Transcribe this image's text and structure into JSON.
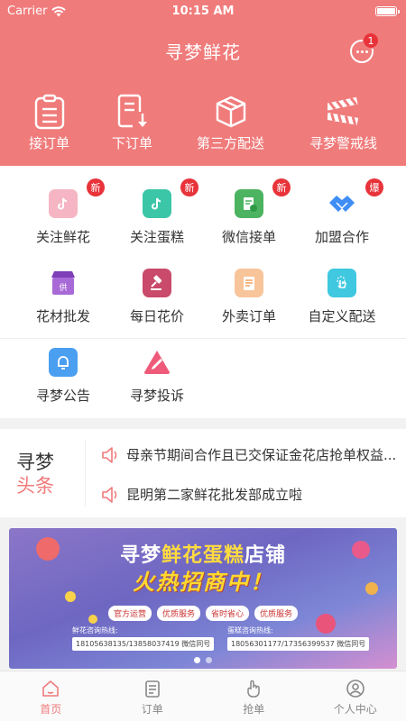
{
  "status_bar": {
    "carrier": "Carrier",
    "time": "10:15 AM"
  },
  "header": {
    "title": "寻梦鲜花",
    "message_badge": "1",
    "quick_actions": [
      {
        "label": "接订单",
        "icon": "receive-order-icon"
      },
      {
        "label": "下订单",
        "icon": "place-order-icon"
      },
      {
        "label": "第三方配送",
        "icon": "box-delivery-icon"
      },
      {
        "label": "寻梦警戒线",
        "icon": "caution-tape-icon"
      }
    ]
  },
  "grid": [
    {
      "label": "关注鲜花",
      "icon": "tiktok-pink-icon",
      "color": "#f2a0b3",
      "badge": "新"
    },
    {
      "label": "关注蛋糕",
      "icon": "tiktok-teal-icon",
      "color": "#3bc6a8",
      "badge": "新"
    },
    {
      "label": "微信接单",
      "icon": "wechat-doc-icon",
      "color": "#4cb361",
      "badge": "新"
    },
    {
      "label": "加盟合作",
      "icon": "handshake-icon",
      "color": "#3f8ef5",
      "badge": "爆"
    },
    {
      "label": "花材批发",
      "icon": "shop-icon",
      "color": "#9a5bc7",
      "badge": ""
    },
    {
      "label": "每日花价",
      "icon": "auction-icon",
      "color": "#c94a6a",
      "badge": ""
    },
    {
      "label": "外卖订单",
      "icon": "takeout-doc-icon",
      "color": "#f0a060",
      "badge": ""
    },
    {
      "label": "自定义配送",
      "icon": "tap-icon",
      "color": "#3fc8e0",
      "badge": ""
    },
    {
      "label": "寻梦公告",
      "icon": "bell-icon",
      "color": "#4a9ff0",
      "badge": ""
    },
    {
      "label": "寻梦投诉",
      "icon": "complaint-icon",
      "color": "#f05a7a",
      "badge": ""
    }
  ],
  "news": {
    "brand_line1": "寻梦",
    "brand_line2": "头条",
    "items": [
      "母亲节期间合作且已交保证金花店抢单权益...",
      "昆明第二家鲜花批发部成立啦"
    ]
  },
  "banner": {
    "title_a": "寻梦",
    "title_b": "鲜花蛋糕",
    "title_c": "店铺",
    "subtitle": "火热招商中！",
    "tags": [
      "官方运营",
      "优质服务",
      "省时省心",
      "优质服务"
    ],
    "left_label": "鲜花咨询热线:",
    "left_phones": "18105638135/13858037419  微信同号",
    "right_label": "蛋糕咨询热线:",
    "right_phones": "18056301177/17356399537  微信同号"
  },
  "tabbar": [
    {
      "label": "首页",
      "icon": "home-icon",
      "active": true
    },
    {
      "label": "订单",
      "icon": "order-list-icon",
      "active": false
    },
    {
      "label": "抢单",
      "icon": "grab-hand-icon",
      "active": false
    },
    {
      "label": "个人中心",
      "icon": "profile-icon",
      "active": false
    }
  ],
  "colors": {
    "primary": "#f07b7b",
    "badge_red": "#e8333a"
  }
}
